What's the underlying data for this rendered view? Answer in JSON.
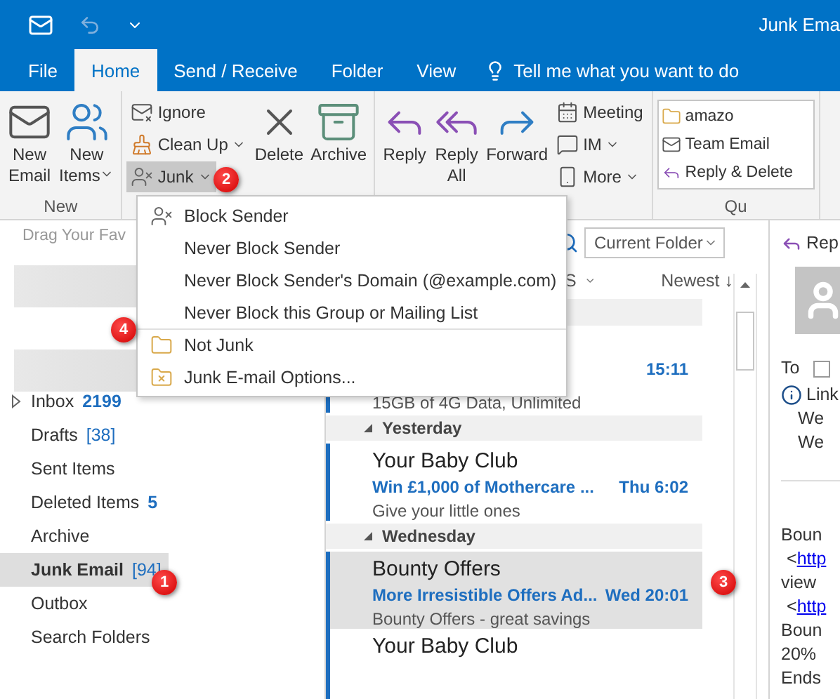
{
  "title_bar": {
    "title": "Junk Ema"
  },
  "tabs": [
    {
      "label": "File",
      "selected": false
    },
    {
      "label": "Home",
      "selected": true
    },
    {
      "label": "Send / Receive",
      "selected": false
    },
    {
      "label": "Folder",
      "selected": false
    },
    {
      "label": "View",
      "selected": false
    }
  ],
  "tell_me": {
    "placeholder": "Tell me what you want to do"
  },
  "ribbon": {
    "groups": [
      {
        "label": "New",
        "columns": [
          {
            "kind": "large",
            "items": [
              {
                "lines": [
                  "New",
                  "Email"
                ],
                "dropdown": false,
                "pressed": false
              }
            ]
          },
          {
            "kind": "large",
            "items": [
              {
                "lines": [
                  "New",
                  "Items"
                ],
                "dropdown": true,
                "pressed": false
              }
            ]
          }
        ]
      },
      {
        "columns": [
          {
            "kind": "small",
            "items": [
              {
                "lines": [
                  "Ignore"
                ],
                "dropdown": false,
                "pressed": false
              },
              {
                "lines": [
                  "Clean Up"
                ],
                "dropdown": true,
                "pressed": false
              },
              {
                "lines": [
                  "Junk"
                ],
                "dropdown": true,
                "pressed": true
              }
            ]
          },
          {
            "kind": "large",
            "items": [
              {
                "lines": [
                  "Delete"
                ],
                "dropdown": false,
                "pressed": false
              }
            ]
          },
          {
            "kind": "large",
            "items": [
              {
                "lines": [
                  "Archive"
                ],
                "dropdown": false,
                "pressed": false
              }
            ]
          }
        ]
      },
      {
        "columns": [
          {
            "kind": "large",
            "items": [
              {
                "lines": [
                  "Reply"
                ],
                "dropdown": false,
                "pressed": false
              }
            ]
          },
          {
            "kind": "large",
            "items": [
              {
                "lines": [
                  "Reply",
                  "All"
                ],
                "dropdown": false,
                "pressed": false
              }
            ]
          },
          {
            "kind": "large",
            "items": [
              {
                "lines": [
                  "Forward"
                ],
                "dropdown": false,
                "pressed": false
              }
            ]
          },
          {
            "kind": "small",
            "items": [
              {
                "lines": [
                  "Meeting"
                ],
                "dropdown": false,
                "pressed": false
              },
              {
                "lines": [
                  "IM"
                ],
                "dropdown": true,
                "pressed": false
              },
              {
                "lines": [
                  "More"
                ],
                "dropdown": true,
                "pressed": false
              }
            ]
          }
        ]
      },
      {
        "label": "Qu",
        "columns": [
          {
            "kind": "quick",
            "items": [
              {
                "lines": [
                  "amazo"
                ]
              },
              {
                "lines": [
                  "Team Email"
                ]
              },
              {
                "lines": [
                  "Reply & Delete"
                ]
              }
            ]
          }
        ]
      }
    ]
  },
  "junk_menu": {
    "items": [
      {
        "label": "Block Sender",
        "divider_before": false
      },
      {
        "label": "Never Block Sender",
        "divider_before": false
      },
      {
        "label": "Never Block Sender's Domain (@example.com)",
        "divider_before": false
      },
      {
        "label": "Never Block this Group or Mailing List",
        "divider_before": false
      },
      {
        "label": "Not Junk",
        "divider_before": true
      },
      {
        "label": "Junk E-mail Options...",
        "divider_before": false
      }
    ]
  },
  "sidebar": {
    "favorites_hint": "Drag Your Fav",
    "folders": [
      {
        "name": "Inbox",
        "count": "2199",
        "kind": "unread",
        "expandable": true,
        "selected": false
      },
      {
        "name": "Drafts",
        "count": "[38]",
        "kind": "total",
        "expandable": false,
        "selected": false
      },
      {
        "name": "Sent Items",
        "expandable": false,
        "selected": false
      },
      {
        "name": "Deleted Items",
        "count": "5",
        "kind": "unread",
        "expandable": false,
        "selected": false
      },
      {
        "name": "Archive",
        "expandable": false,
        "selected": false
      },
      {
        "name": "Junk Email",
        "count": "[94]",
        "kind": "total",
        "expandable": false,
        "selected": true
      },
      {
        "name": "Outbox",
        "expandable": false,
        "selected": false
      },
      {
        "name": "Search Folders",
        "expandable": false,
        "selected": false
      }
    ]
  },
  "message_list": {
    "scope": "Current Folder",
    "filter_label": "S",
    "sort": "Newest ↓",
    "groups": [
      {
        "messages": [
          {
            "time": "15:11",
            "preview": "15GB of 4G Data, Unlimited",
            "unread": true,
            "selected": false
          }
        ]
      },
      {
        "title": "Yesterday",
        "messages": [
          {
            "sender": "Your Baby Club",
            "subject": "Win £1,000 of Mothercare ...",
            "time": "Thu 6:02",
            "preview": "Give your little ones",
            "unread": true,
            "selected": false
          }
        ]
      },
      {
        "title": "Wednesday",
        "messages": [
          {
            "sender": "Bounty Offers",
            "subject": "More Irresistible Offers Ad...",
            "time": "Wed 20:01",
            "preview": "Bounty Offers - great savings",
            "unread": true,
            "selected": true
          },
          {
            "sender": "Your Baby Club",
            "unread": true,
            "selected": false
          }
        ]
      }
    ]
  },
  "reading_pane": {
    "reply": "Rep",
    "to_label": "To",
    "checkbox": {
      "checked": false
    },
    "info": {
      "title": "Link",
      "lines": [
        "We",
        "We"
      ]
    },
    "body": [
      {
        "text": "Boun"
      },
      {
        "prefix": "<",
        "link": "http"
      },
      {
        "text": "view"
      },
      {
        "prefix": "<",
        "link": "http"
      },
      {
        "text": "Boun"
      },
      {
        "text": "20%"
      },
      {
        "text": "Ends"
      }
    ]
  },
  "annotations": [
    {
      "label": "1"
    },
    {
      "label": "2"
    },
    {
      "label": "3"
    },
    {
      "label": "4"
    }
  ]
}
